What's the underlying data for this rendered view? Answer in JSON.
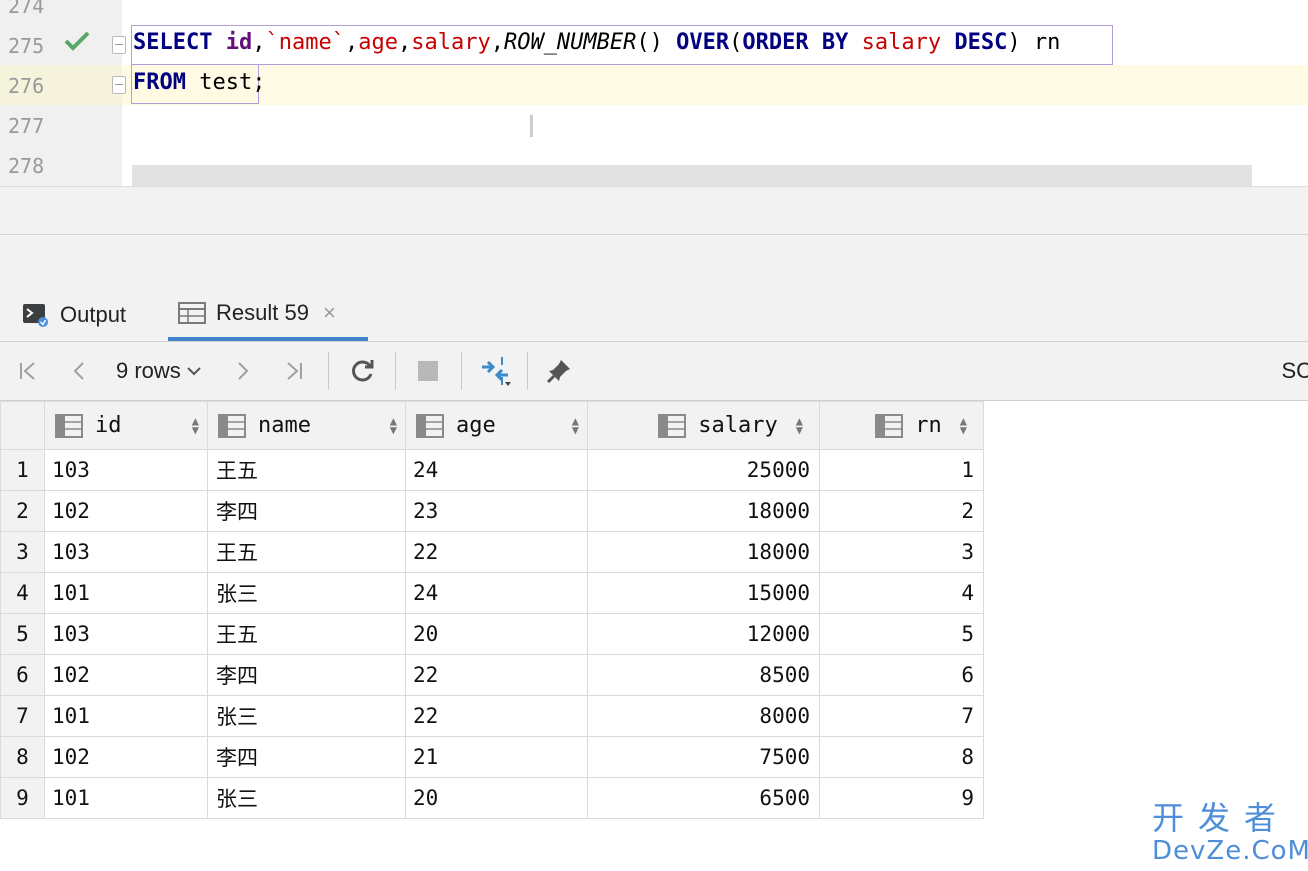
{
  "editor": {
    "line_numbers": [
      "274",
      "275",
      "276",
      "277",
      "278"
    ],
    "line1": {
      "select": "SELECT",
      "id": "id",
      "c1": ",",
      "name": "`name`",
      "c2": ",",
      "age": "age",
      "c3": ",",
      "salary": "salary",
      "c4": ",",
      "fn": "ROW_NUMBER",
      "paren": "() ",
      "over": "OVER",
      "open": "(",
      "orderby": "ORDER BY",
      "salary2": "salary",
      "desc": "DESC",
      "close": ") rn"
    },
    "line2": {
      "from": "FROM",
      "table": " test",
      "semi": ";"
    }
  },
  "tabs": {
    "output_label": "Output",
    "result_label": "Result 59",
    "close_glyph": "×"
  },
  "toolbar": {
    "rows_label": "9 rows",
    "sql_label": "SC"
  },
  "grid": {
    "columns": [
      "id",
      "name",
      "age",
      "salary",
      "rn"
    ],
    "rows": [
      {
        "n": "1",
        "id": "103",
        "name": "王五",
        "age": "24",
        "salary": "25000",
        "rn": "1"
      },
      {
        "n": "2",
        "id": "102",
        "name": "李四",
        "age": "23",
        "salary": "18000",
        "rn": "2"
      },
      {
        "n": "3",
        "id": "103",
        "name": "王五",
        "age": "22",
        "salary": "18000",
        "rn": "3"
      },
      {
        "n": "4",
        "id": "101",
        "name": "张三",
        "age": "24",
        "salary": "15000",
        "rn": "4"
      },
      {
        "n": "5",
        "id": "103",
        "name": "王五",
        "age": "20",
        "salary": "12000",
        "rn": "5"
      },
      {
        "n": "6",
        "id": "102",
        "name": "李四",
        "age": "22",
        "salary": "8500",
        "rn": "6"
      },
      {
        "n": "7",
        "id": "101",
        "name": "张三",
        "age": "22",
        "salary": "8000",
        "rn": "7"
      },
      {
        "n": "8",
        "id": "102",
        "name": "李四",
        "age": "21",
        "salary": "7500",
        "rn": "8"
      },
      {
        "n": "9",
        "id": "101",
        "name": "张三",
        "age": "20",
        "salary": "6500",
        "rn": "9"
      }
    ]
  },
  "watermark": {
    "cn": "开发者",
    "en": "DevZe.CoM"
  },
  "colors": {
    "keyword": "#000080",
    "identifier": "#660e7a",
    "column": "#c80000",
    "selection_border": "#b39ddb",
    "active_line": "#fefae3",
    "tab_underline": "#4083c9",
    "watermark": "#4f8ed8"
  }
}
